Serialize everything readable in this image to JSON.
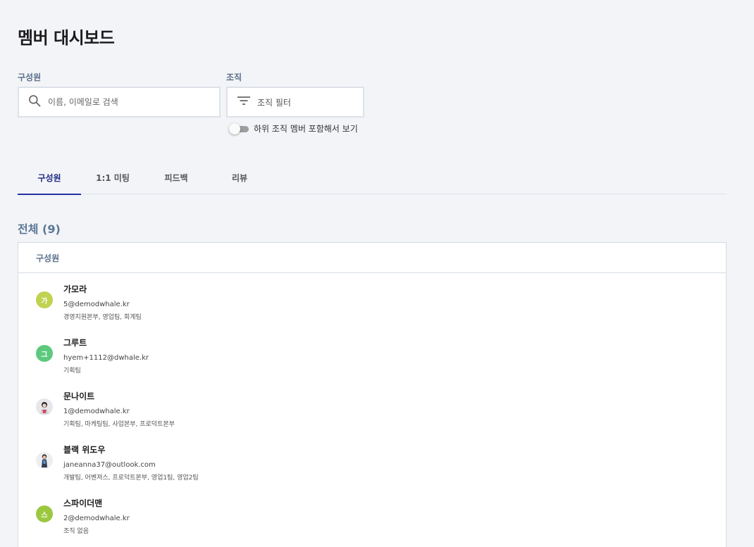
{
  "page": {
    "title": "멤버 대시보드"
  },
  "filters": {
    "members_label": "구성원",
    "search_placeholder": "이름, 이메일로 검색",
    "org_label": "조직",
    "org_filter_label": "조직 필터",
    "include_sub_orgs_label": "하위 조직 멤버 포함해서 보기",
    "include_sub_orgs_on": false
  },
  "tabs": [
    {
      "label": "구성원",
      "active": true
    },
    {
      "label": "1:1 미팅",
      "active": false
    },
    {
      "label": "피드백",
      "active": false
    },
    {
      "label": "리뷰",
      "active": false
    }
  ],
  "section": {
    "title": "전체 (9)"
  },
  "table": {
    "header": "구성원",
    "rows": [
      {
        "avatar_type": "initial",
        "initial": "가",
        "avatar_color": "#c0d24f",
        "name": "가모라",
        "email": "5@demodwhale.kr",
        "orgs": "경영지원본부, 영업팀, 회계팀"
      },
      {
        "avatar_type": "initial",
        "initial": "그",
        "avatar_color": "#5cc97c",
        "name": "그루트",
        "email": "hyem+1112@dwhale.kr",
        "orgs": "기획팀"
      },
      {
        "avatar_type": "photo",
        "initial": "",
        "avatar_color": "#e8e6ea",
        "name": "문나이트",
        "email": "1@demodwhale.kr",
        "orgs": "기획팀, 마케팅팀, 사업본부, 프로덕트본부"
      },
      {
        "avatar_type": "photo",
        "initial": "",
        "avatar_color": "#eeeeee",
        "name": "블랙 위도우",
        "email": "janeanna37@outlook.com",
        "orgs": "개발팀, 어벤져스, 프로덕트본부, 영업1팀, 영업2팀"
      },
      {
        "avatar_type": "initial",
        "initial": "스",
        "avatar_color": "#9bc840",
        "name": "스파이더맨",
        "email": "2@demodwhale.kr",
        "orgs": "조직 없음"
      }
    ]
  },
  "colors": {
    "accent": "#2233a5",
    "background": "#f3f4f7",
    "label": "#5b6f8a"
  },
  "icons": {
    "search": "search-icon",
    "filter": "filter-icon"
  }
}
